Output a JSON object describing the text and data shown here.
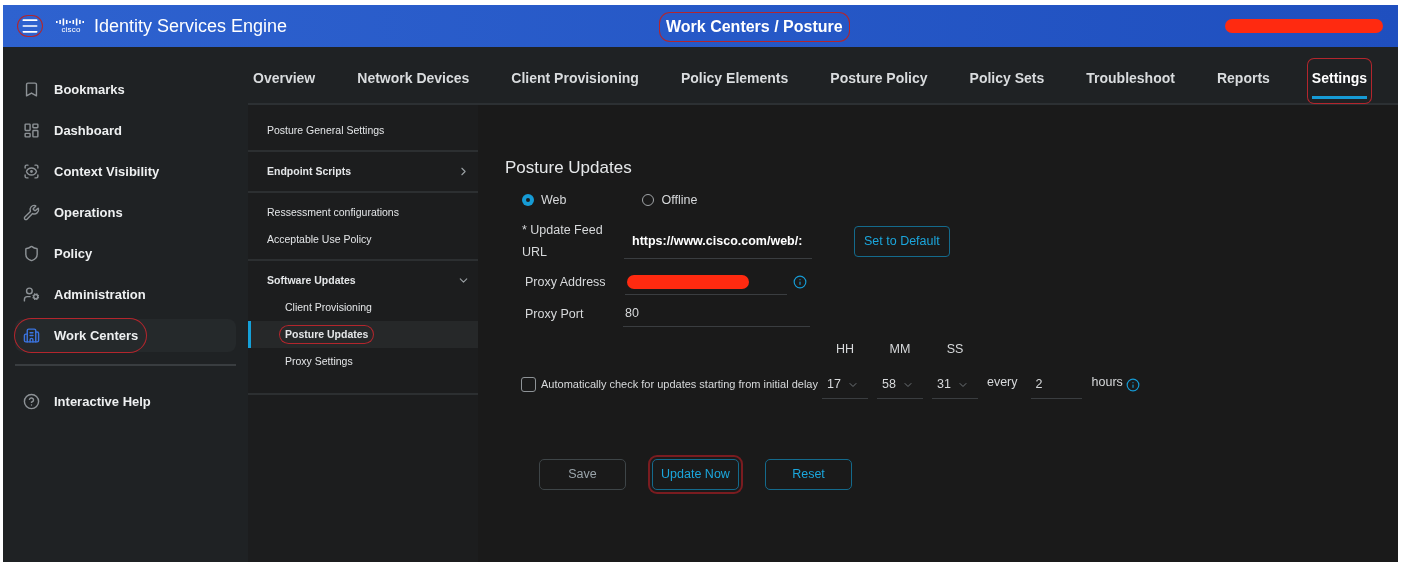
{
  "header": {
    "menu_circled": true,
    "logo_text": "cisco",
    "app_title": "Identity Services Engine",
    "breadcrumb": {
      "text": "Work Centers / Posture",
      "circled": true
    },
    "user_redacted": true
  },
  "sidebar": {
    "items": [
      {
        "label": "Bookmarks",
        "kind": "bookmark",
        "selected": false,
        "circled": false
      },
      {
        "label": "Dashboard",
        "kind": "dashboard",
        "selected": false,
        "circled": false
      },
      {
        "label": "Context Visibility",
        "kind": "visibility",
        "selected": false,
        "circled": false
      },
      {
        "label": "Operations",
        "kind": "wrench",
        "selected": false,
        "circled": false
      },
      {
        "label": "Policy",
        "kind": "shield",
        "selected": false,
        "circled": false
      },
      {
        "label": "Administration",
        "kind": "admin",
        "selected": false,
        "circled": false
      },
      {
        "label": "Work Centers",
        "kind": "workcenters",
        "selected": true,
        "circled": true
      }
    ],
    "footer_items": [
      {
        "label": "Interactive Help",
        "kind": "help"
      }
    ]
  },
  "tabs": [
    {
      "label": "Overview",
      "selected": false,
      "circled": false
    },
    {
      "label": "Network Devices",
      "selected": false,
      "circled": false
    },
    {
      "label": "Client Provisioning",
      "selected": false,
      "circled": false
    },
    {
      "label": "Policy Elements",
      "selected": false,
      "circled": false
    },
    {
      "label": "Posture Policy",
      "selected": false,
      "circled": false
    },
    {
      "label": "Policy Sets",
      "selected": false,
      "circled": false
    },
    {
      "label": "Troubleshoot",
      "selected": false,
      "circled": false
    },
    {
      "label": "Reports",
      "selected": false,
      "circled": false
    },
    {
      "label": "Settings",
      "selected": true,
      "circled": true
    }
  ],
  "subnav": {
    "groups": [
      {
        "items": [
          {
            "label": "Posture General Settings",
            "kind": "link"
          }
        ]
      },
      {
        "items": [
          {
            "label": "Endpoint Scripts",
            "kind": "folder",
            "expanded": false
          }
        ]
      },
      {
        "items": [
          {
            "label": "Ressessment configurations",
            "kind": "link"
          },
          {
            "label": "Acceptable Use Policy",
            "kind": "link"
          }
        ]
      },
      {
        "items": [
          {
            "label": "Software Updates",
            "kind": "folder",
            "expanded": true,
            "children": [
              {
                "label": "Client Provisioning",
                "selected": false,
                "circled": false
              },
              {
                "label": "Posture Updates",
                "selected": true,
                "circled": true
              },
              {
                "label": "Proxy Settings",
                "selected": false,
                "circled": false
              }
            ]
          }
        ]
      }
    ]
  },
  "form": {
    "title": "Posture Updates",
    "source_options": [
      {
        "label": "Web",
        "selected": true
      },
      {
        "label": "Offline",
        "selected": false
      }
    ],
    "feed_url": {
      "label": "* Update Feed URL",
      "value": "https://www.cisco.com/web/:"
    },
    "set_default_button": "Set to Default",
    "proxy_address": {
      "label": "Proxy Address",
      "redacted": true
    },
    "proxy_port": {
      "label": "Proxy Port",
      "value": "80"
    },
    "schedule": {
      "checked": false,
      "label": "Automatically check for updates starting from initial delay",
      "columns": [
        "HH",
        "MM",
        "SS"
      ],
      "values": [
        "17",
        "58",
        "31"
      ],
      "every_label": "every",
      "interval": "2",
      "unit": "hours"
    },
    "buttons": [
      {
        "label": "Save",
        "kind": "neutral",
        "circled": false
      },
      {
        "label": "Update Now",
        "kind": "accent",
        "circled": true
      },
      {
        "label": "Reset",
        "kind": "accent",
        "circled": false
      }
    ]
  }
}
